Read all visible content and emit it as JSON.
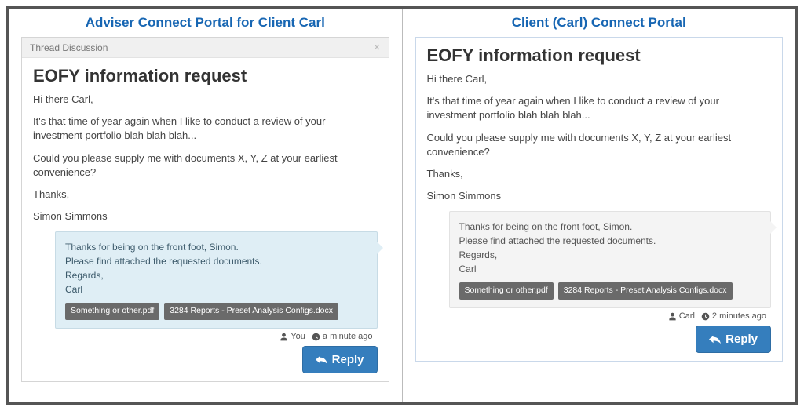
{
  "left": {
    "pane_title": "Adviser Connect Portal for Client Carl",
    "card_header": "Thread Discussion",
    "thread_title": "EOFY information request",
    "paragraphs": [
      "Hi there Carl,",
      "It's that time of year again when I like to conduct a review of your investment portfolio blah blah blah...",
      "Could you please supply me with documents X, Y, Z at your earliest convenience?",
      "Thanks,",
      "Simon Simmons"
    ],
    "reply": {
      "lines": [
        "Thanks for being on the front foot, Simon.",
        "Please find attached the requested documents.",
        "Regards,",
        "Carl"
      ],
      "attachments": [
        "Something or other.pdf",
        "3284 Reports - Preset Analysis Configs.docx"
      ]
    },
    "meta_user": "You",
    "meta_time": "a minute ago",
    "reply_button": "Reply"
  },
  "right": {
    "pane_title": "Client (Carl) Connect Portal",
    "thread_title": "EOFY information request",
    "paragraphs": [
      "Hi there Carl,",
      "It's that time of year again when I like to conduct a review of your investment portfolio blah blah blah...",
      "Could you please supply me with documents X, Y, Z at your earliest convenience?",
      "Thanks,",
      "Simon Simmons"
    ],
    "reply": {
      "lines": [
        "Thanks for being on the front foot, Simon.",
        "Please find attached the requested documents.",
        "Regards,",
        "Carl"
      ],
      "attachments": [
        "Something or other.pdf",
        "3284 Reports - Preset Analysis Configs.docx"
      ]
    },
    "meta_user": "Carl",
    "meta_time": "2 minutes ago",
    "reply_button": "Reply"
  }
}
